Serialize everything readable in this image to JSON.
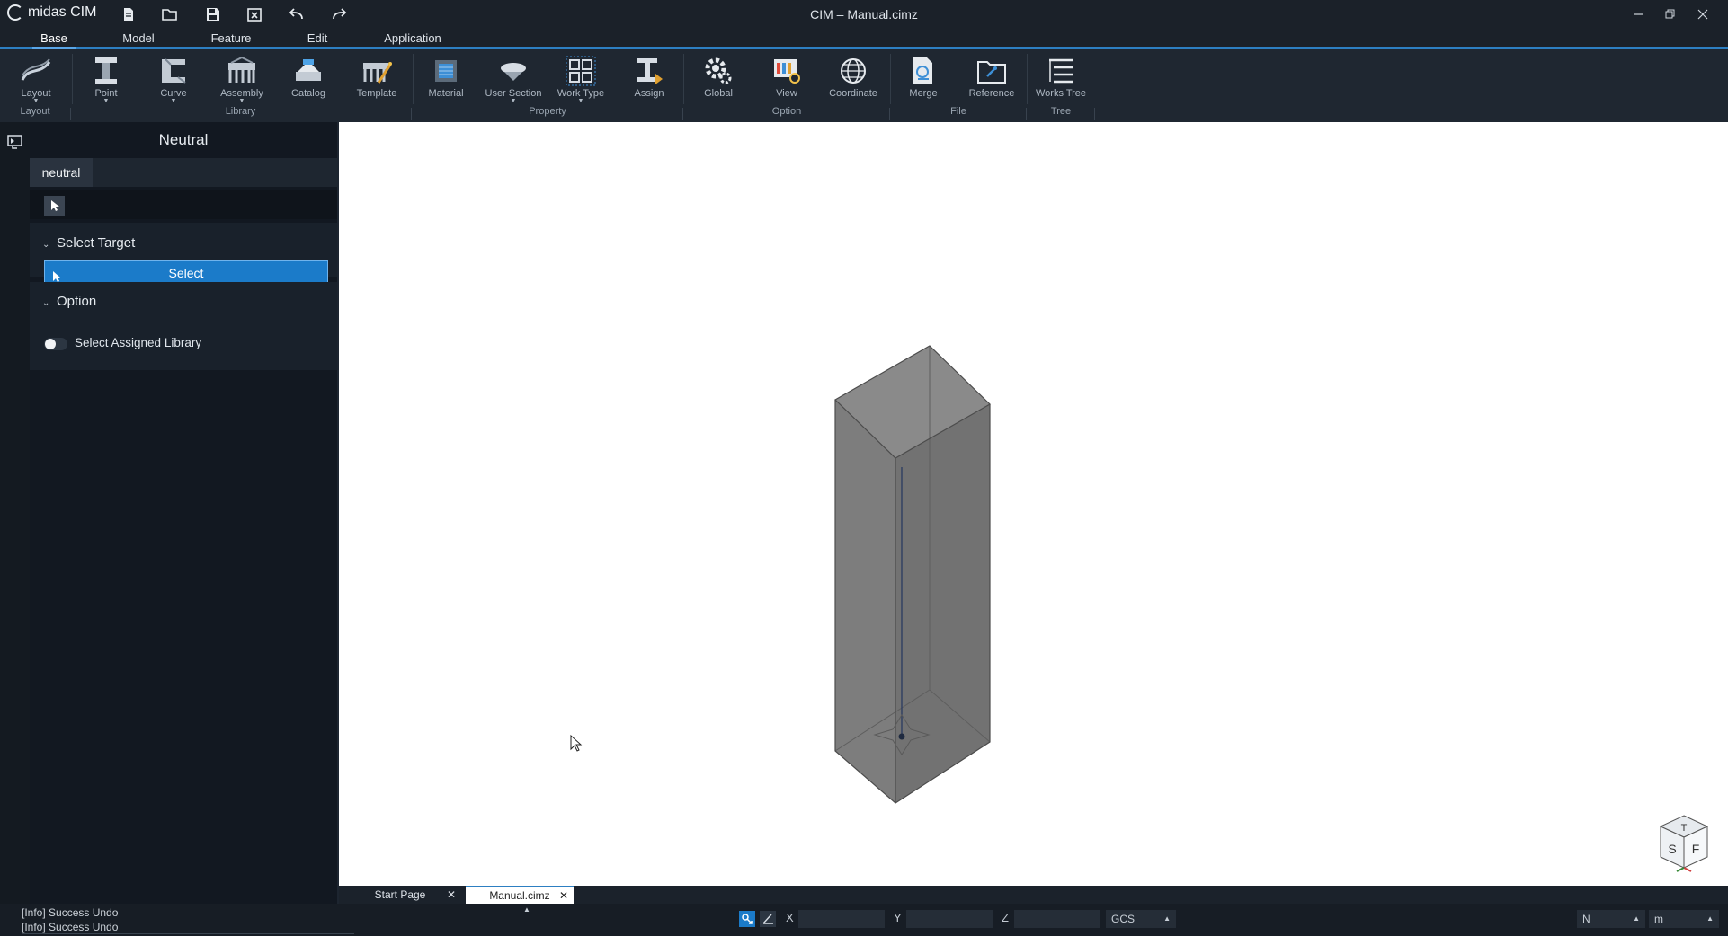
{
  "app": {
    "name": "midas CIM",
    "window_title": "CIM – Manual.cimz"
  },
  "menu": {
    "tabs": [
      "Base",
      "Model",
      "Feature",
      "Edit",
      "Application"
    ],
    "active": "Base"
  },
  "ribbon": {
    "buttons": {
      "layout": "Layout",
      "point": "Point",
      "curve": "Curve",
      "assembly": "Assembly",
      "catalog": "Catalog",
      "template": "Template",
      "material": "Material",
      "user_section": "User Section",
      "work_type": "Work Type",
      "assign": "Assign",
      "global": "Global",
      "view": "View",
      "coordinate": "Coordinate",
      "merge": "Merge",
      "reference": "Reference",
      "works_tree": "Works Tree"
    },
    "groups": {
      "layout": "Layout",
      "library": "Library",
      "property": "Property",
      "option": "Option",
      "file": "File",
      "tree": "Tree"
    }
  },
  "panel": {
    "title": "Neutral",
    "tab": "neutral",
    "select_target": {
      "header": "Select Target",
      "button": "Select"
    },
    "option": {
      "header": "Option",
      "toggle_label": "Select Assigned Library",
      "toggle_on": false
    }
  },
  "navcube": {
    "top": "T",
    "left": "S",
    "right": "F"
  },
  "doc_tabs": [
    {
      "label": "Start Page",
      "active": false
    },
    {
      "label": "Manual.cimz",
      "active": true
    }
  ],
  "status": {
    "log": [
      "[Info] Success Undo",
      "[Info] Success Undo"
    ],
    "coords": {
      "x_label": "X",
      "y_label": "Y",
      "z_label": "Z",
      "system": "GCS"
    },
    "units": {
      "force": "N",
      "length": "m"
    }
  },
  "colors": {
    "accent": "#1b7bc9",
    "ribbon_bg": "#1f2731",
    "viewport_bg": "#ffffff",
    "box_face": "#7a7a7a"
  }
}
